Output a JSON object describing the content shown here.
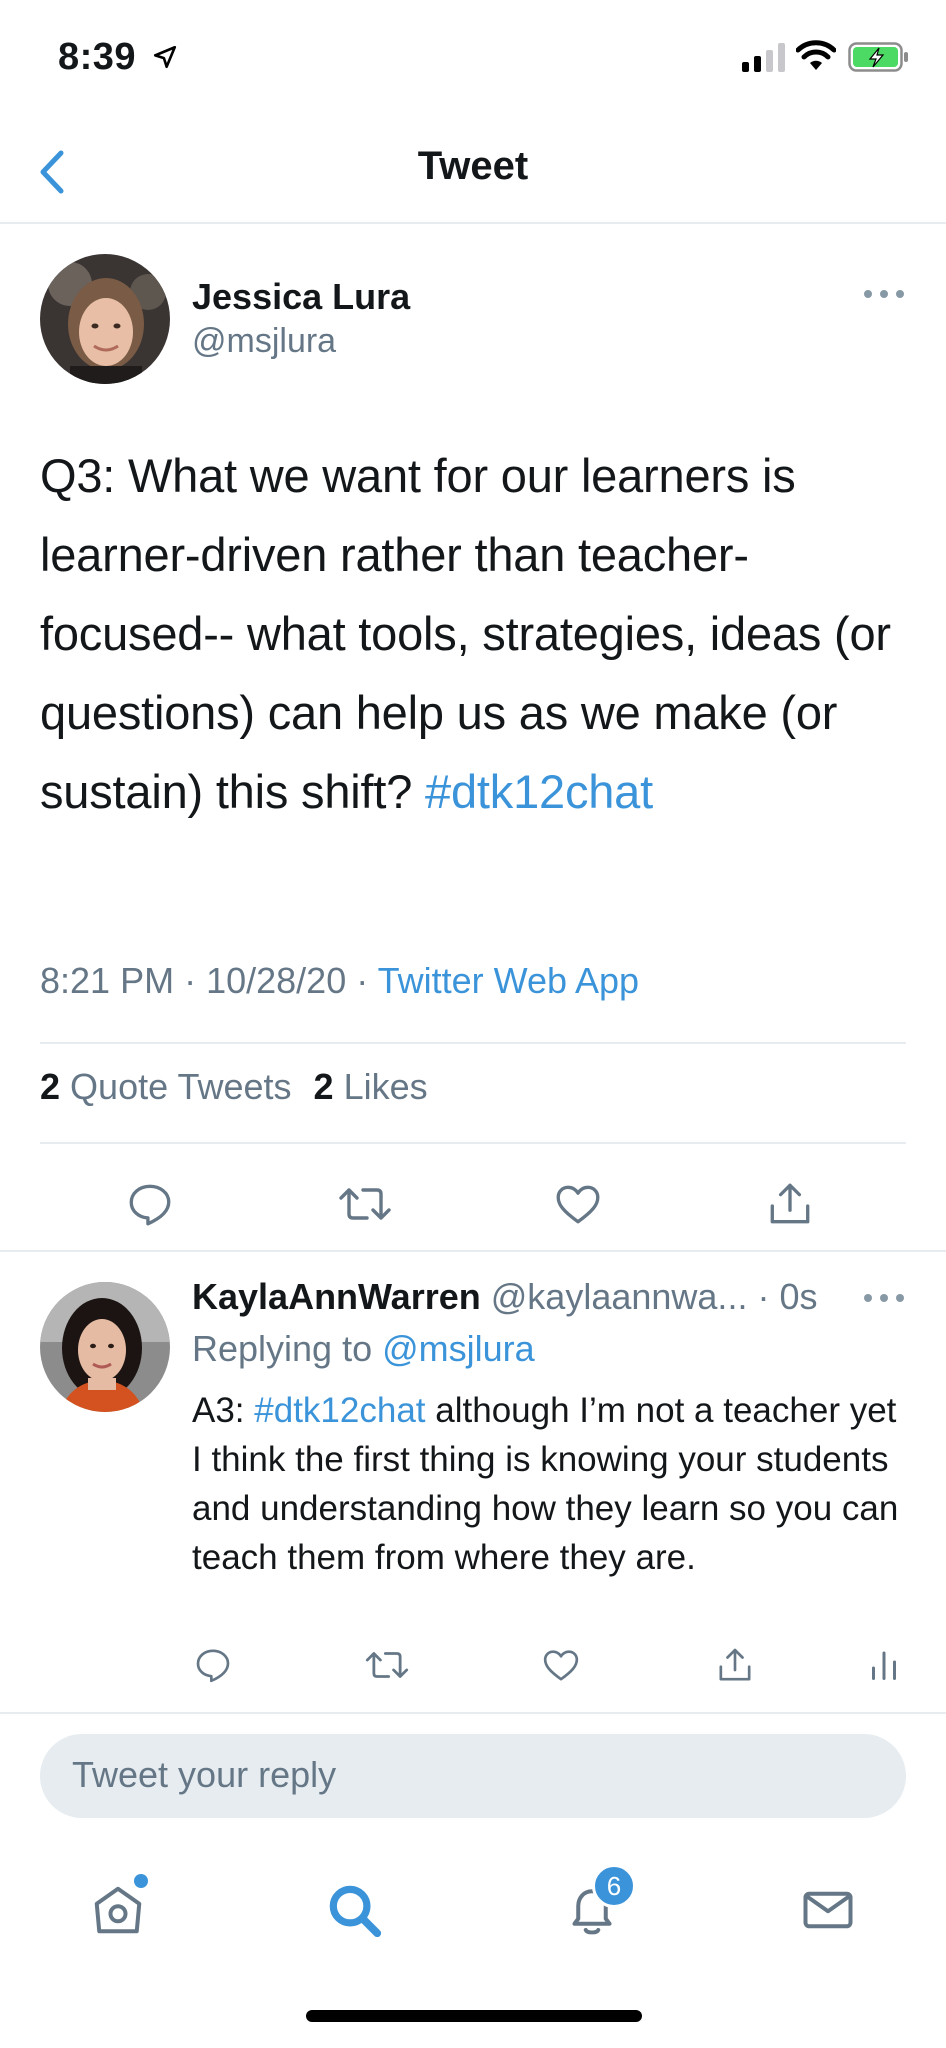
{
  "status_bar": {
    "time": "8:39"
  },
  "nav": {
    "title": "Tweet"
  },
  "tweet": {
    "author_name": "Jessica Lura",
    "author_handle": "@msjlura",
    "text": "Q3: What we want for our learners is learner-driven rather than teacher-focused-- what tools, strategies, ideas (or questions) can help us as we make (or sustain) this shift?",
    "hashtag": "#dtk12chat",
    "time": "8:21 PM",
    "date": "10/28/20",
    "source": "Twitter Web App",
    "quote_tweets_count": "2",
    "quote_tweets_label": "Quote Tweets",
    "likes_count": "2",
    "likes_label": "Likes"
  },
  "reply": {
    "name": "KaylaAnnWarren",
    "handle": "@kaylaannwa...",
    "time": "0s",
    "replying_prefix": "Replying to",
    "replying_to": "@msjlura",
    "text_prefix": "A3:",
    "hashtag": "#dtk12chat",
    "text": "although I’m not a teacher yet I think the first thing is knowing your students and understanding how they learn so you can teach them from where they are."
  },
  "compose": {
    "placeholder": "Tweet your reply"
  },
  "tabbar": {
    "notifications_badge": "6"
  },
  "colors": {
    "accent": "#3b94d9",
    "secondary_text": "#657786",
    "divider": "#e6ecf0",
    "battery": "#4cd964"
  }
}
